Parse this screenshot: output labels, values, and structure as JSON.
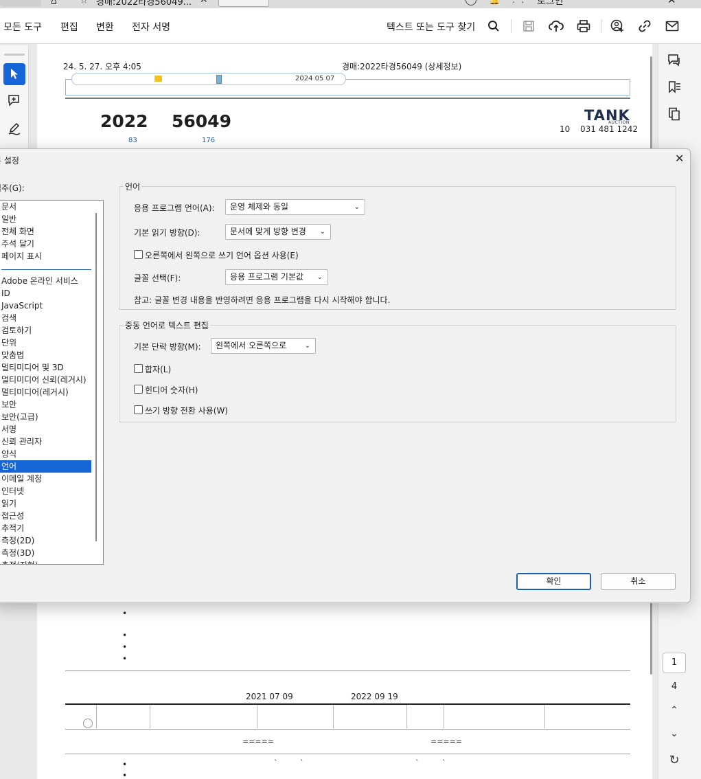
{
  "tabstrip": {
    "tab_title": "경매:2022타경56049...",
    "login": "로그인"
  },
  "menubar": {
    "items": [
      "모든 도구",
      "편집",
      "변환",
      "전자 서명"
    ],
    "find_tools": "텍스트 또는 도구 찾기"
  },
  "document": {
    "header_left": "24. 5. 27. 오후 4:05",
    "header_right": "경매:2022타경56049 (상세정보)",
    "timeline_date": "2024 05 07",
    "case_year": "2022",
    "case_number": "56049",
    "sub1": "83",
    "sub2": "176",
    "logo": "TANK",
    "logo_sub": "AUCTION",
    "contact_a": "10",
    "contact_b": "031 481 1242",
    "bullet": "•",
    "date1": "2021 07 09",
    "date2": "2022 09 19",
    "eq": "=====",
    "tick": "`"
  },
  "rail": {
    "page_current": "1",
    "page_total": "4"
  },
  "dialog": {
    "title": "본 설정",
    "category_label": "범주(G):",
    "categories_top": [
      "문서",
      "일반",
      "전체 화면",
      "주석 달기",
      "페이지 표시"
    ],
    "categories": [
      "Adobe 온라인 서비스",
      "ID",
      "JavaScript",
      "검색",
      "검토하기",
      "단위",
      "맞춤법",
      "멀티미디어 및 3D",
      "멀티미디어 신뢰(레거시)",
      "멀티미디어(레거시)",
      "보안",
      "보안(고급)",
      "서명",
      "신뢰 관리자",
      "양식",
      "언어",
      "이메일 계정",
      "인터넷",
      "읽기",
      "접근성",
      "추적기",
      "측정(2D)",
      "측정(3D)",
      "측정(지형)"
    ],
    "language_group": "언어",
    "app_language_label": "응용 프로그램 언어(A):",
    "app_language_value": "운영 체제와 동일",
    "reading_dir_label": "기본 읽기 방향(D):",
    "reading_dir_value": "문서에 맞게 방향 변경",
    "rtl_option": "오른쪽에서 왼쪽으로 쓰기 언어 옵션 사용(E)",
    "font_label": "글꼴 선택(F):",
    "font_value": "응용 프로그램 기본값",
    "note": "참고: 글꼴 변경 내용을 반영하려면 응용 프로그램을 다시 시작해야 합니다.",
    "mideast_group": "중동 언어로 텍스트 편집",
    "para_dir_label": "기본 단락 방향(M):",
    "para_dir_value": "왼쪽에서 오른쪽으로",
    "ligatures": "합자(L)",
    "hindi_digits": "힌디어 숫자(H)",
    "dir_switch": "쓰기 방향 전환 사용(W)",
    "ok": "확인",
    "cancel": "취소"
  }
}
